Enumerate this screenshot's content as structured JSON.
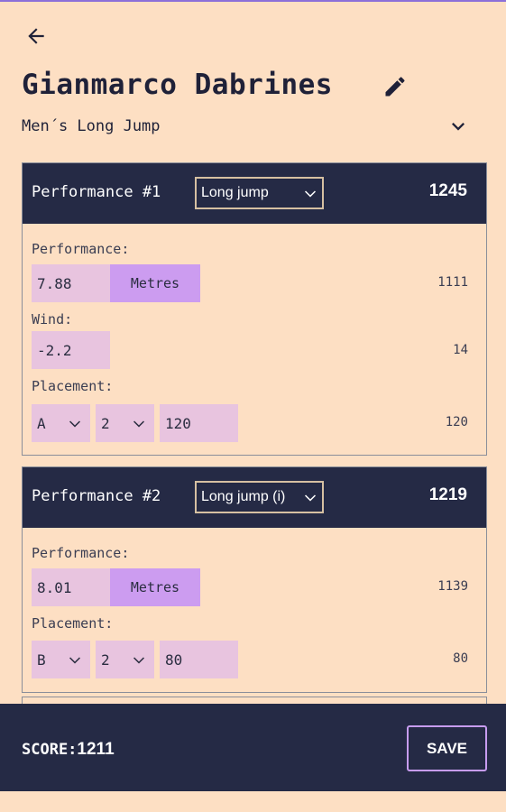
{
  "header": {
    "athlete_name": "Gianmarco Dabrines",
    "event": "Men´s Long Jump"
  },
  "performances": [
    {
      "title": "Performance #1",
      "type": "Long jump",
      "score": "1245",
      "performance_label": "Performance:",
      "mark": "7.88",
      "unit": "Metres",
      "mark_points": "1111",
      "wind_label": "Wind:",
      "wind": "-2.2",
      "wind_points": "14",
      "placement_label": "Placement:",
      "round": "A",
      "place": "2",
      "placement_value": "120",
      "placement_points": "120"
    },
    {
      "title": "Performance #2",
      "type": "Long jump (i)",
      "score": "1219",
      "performance_label": "Performance:",
      "mark": "8.01",
      "unit": "Metres",
      "mark_points": "1139",
      "placement_label": "Placement:",
      "round": "B",
      "place": "2",
      "placement_value": "80",
      "placement_points": "80"
    }
  ],
  "footer": {
    "score_label": "SCORE:",
    "score_value": "1211",
    "save_label": "SAVE"
  },
  "colors": {
    "background": "#fddfc3",
    "navy": "#252a45",
    "field": "#e8c4df",
    "accent": "#cc9cf0"
  }
}
